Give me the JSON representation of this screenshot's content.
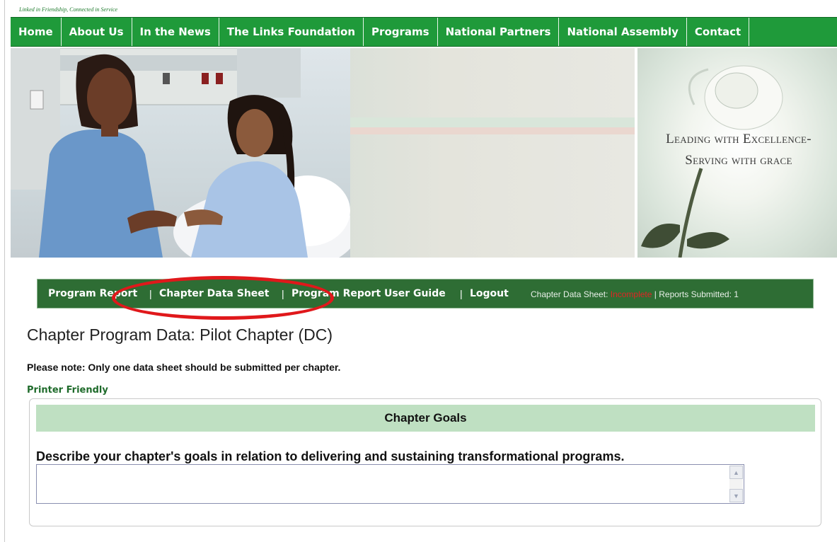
{
  "header": {
    "tagline": "Linked in Friendship, Connected in Service"
  },
  "topnav": {
    "items": [
      "Home",
      "About Us",
      "In the News",
      "The Links Foundation",
      "Programs",
      "National Partners",
      "National Assembly",
      "Contact"
    ]
  },
  "banner": {
    "line1": "Leading with Excellence-",
    "line2": "Serving with grace"
  },
  "subnav": {
    "program_report": "Program Report",
    "chapter_data_sheet": "Chapter Data Sheet",
    "user_guide": "Program Report User Guide",
    "logout": "Logout",
    "separator": "|",
    "status_label": "Chapter Data Sheet: ",
    "status_value": "Incomplete",
    "reports_label": " | Reports Submitted: 1"
  },
  "main": {
    "title": "Chapter Program Data: Pilot Chapter (DC)",
    "note": "Please note: Only one data sheet should be submitted per chapter.",
    "printer_friendly": "Printer Friendly"
  },
  "goals": {
    "header": "Chapter Goals",
    "question": "Describe your chapter's goals in relation to delivering and sustaining transformational programs.",
    "value": ""
  },
  "colors": {
    "nav_green": "#1f9a3a",
    "subnav_green": "#2e6d34",
    "header_light_green": "#bfe0c2",
    "highlight_red": "#e0181b"
  }
}
